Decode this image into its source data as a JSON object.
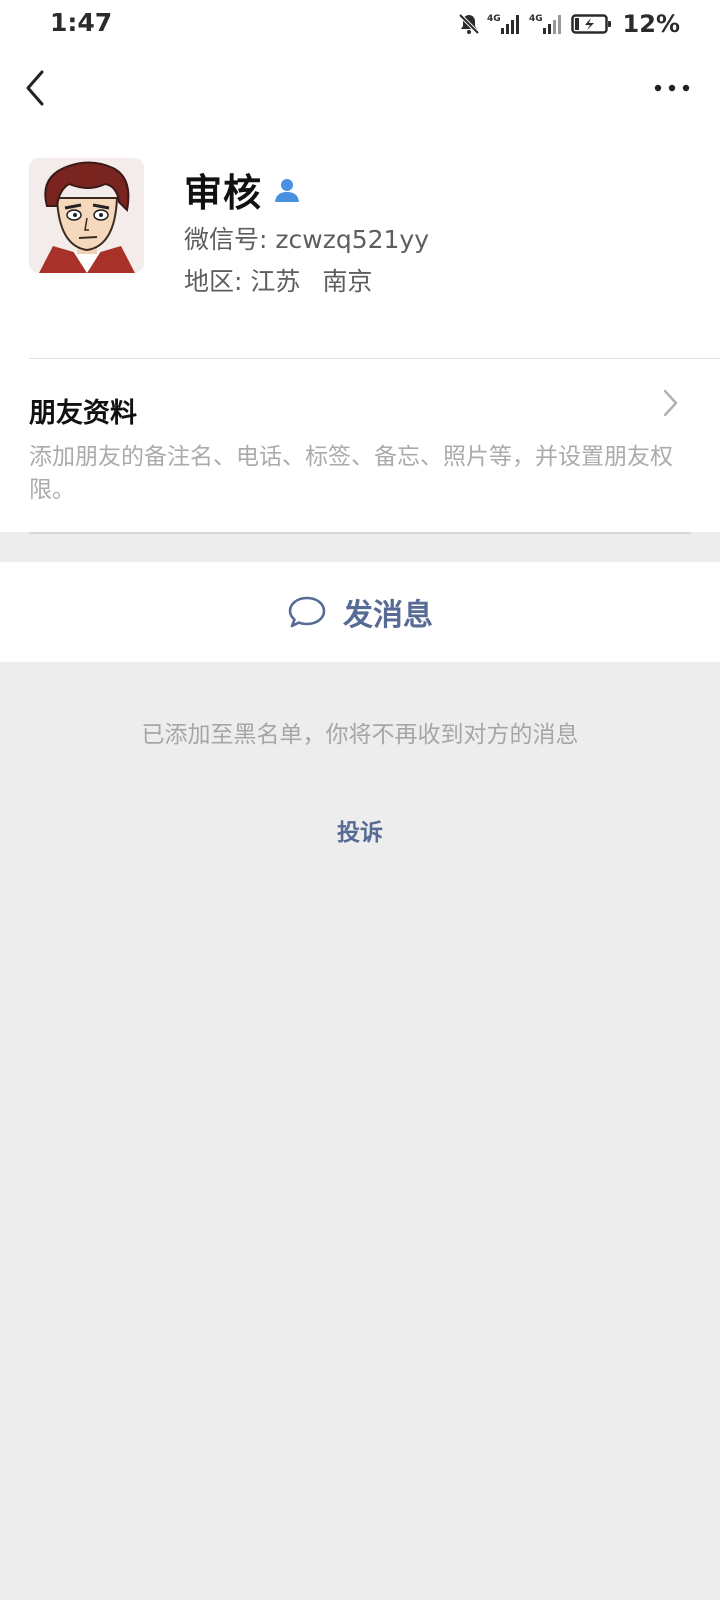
{
  "status_bar": {
    "time": "1:47",
    "network_1": "4G",
    "network_2": "4G",
    "battery_percent": "12%"
  },
  "profile": {
    "name": "审核",
    "wechat_id_label": "微信号:",
    "wechat_id": "zcwzq521yy",
    "region_label": "地区:",
    "region_province": "江苏",
    "region_city": "南京"
  },
  "friend_info": {
    "title": "朋友资料",
    "description": "添加朋友的备注名、电话、标签、备忘、照片等，并设置朋友权限。"
  },
  "send_message": {
    "label": "发消息"
  },
  "blacklist_notice": "已添加至黑名单，你将不再收到对方的消息",
  "complaint": "投诉",
  "colors": {
    "link_blue": "#576b95",
    "contact_icon_blue": "#4a90e2",
    "background_gray": "#ededed"
  }
}
